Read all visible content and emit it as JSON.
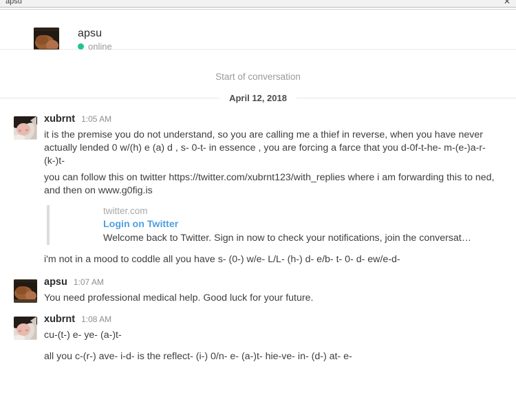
{
  "window": {
    "title": "apsu",
    "close_icon": "close-icon",
    "close_glyph": "✕"
  },
  "header": {
    "name": "apsu",
    "status": "online",
    "status_color": "#1fc48b",
    "avatar_name": "apsu-avatar"
  },
  "conversation": {
    "start_label": "Start of conversation",
    "date_label": "April 12, 2018",
    "link_color": "#4d9fe0"
  },
  "messages": [
    {
      "author": "xubrnt",
      "time": "1:05 AM",
      "paragraphs": [
        "it is the premise you do not understand, so you are calling me a thief in reverse, when you have never actually lended 0 w/(h) e (a) d , s- 0-t- in essence , you are forcing a farce that you d-0f-t-he- m-(e-)a-r- (k-)t-",
        "you can follow this on twitter https://twitter.com/xubrnt123/with_replies where i am forwarding this to ned, and then on www.g0fig.is"
      ],
      "preview": {
        "site": "twitter.com",
        "title": "Login on Twitter",
        "description": "Welcome back to Twitter. Sign in now to check your notifications, join the conversat…"
      },
      "trailing": "i'm not in a mood to coddle all you have s- (0-) w/e- L/L- (h-) d- e/b- t- 0- d- ew/e-d-"
    },
    {
      "author": "apsu",
      "time": "1:07 AM",
      "paragraphs": [
        "You need professional medical help. Good luck for your future."
      ]
    },
    {
      "author": "xubrnt",
      "time": "1:08 AM",
      "paragraphs": [
        "cu-(t-) e- ye- (a-)t-",
        "all you c-(r-) ave- i-d- is the reflect- (i-) 0/n- e- (a-)t- hie-ve- in- (d-) at- e-"
      ]
    }
  ]
}
